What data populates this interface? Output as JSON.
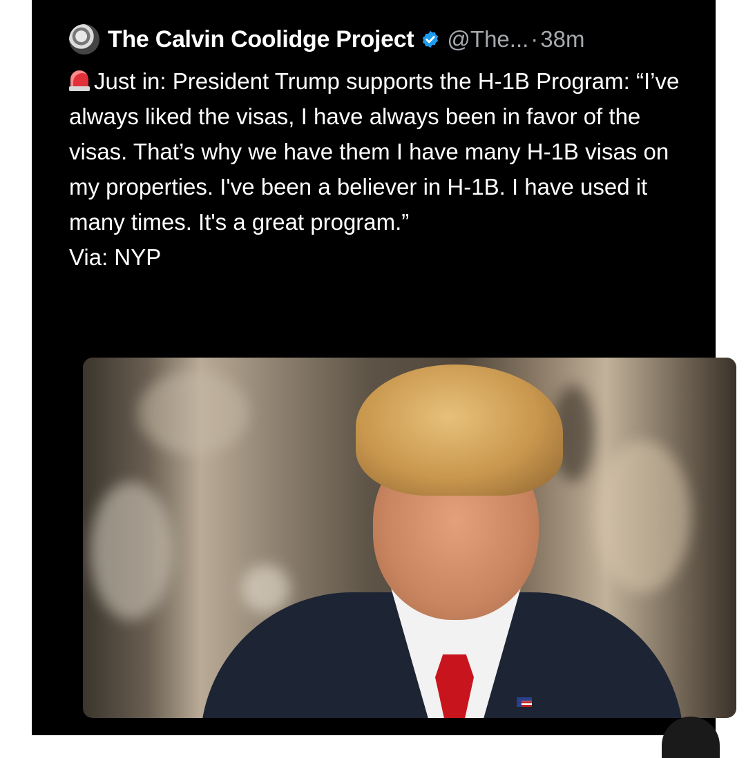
{
  "tweet": {
    "author_name": "The Calvin Coolidge Project",
    "handle": "@The...",
    "separator": "·",
    "time": "38m",
    "body_text": "Just in: President Trump supports the H-1B Program: “I’ve always liked the visas, I have always been in favor of the visas. That’s why we have them I have many H-1B visas on my properties. I've been a believer in H-1B. I have used it many times. It's a great program.”",
    "via_text": "Via: NYP",
    "icons": {
      "avatar": "avatar-image",
      "verified": "verified-badge-icon",
      "siren": "siren-emoji-icon"
    },
    "colors": {
      "background": "#000000",
      "text": "#ffffff",
      "secondary_text": "#a4a9ae",
      "verified_blue": "#1d9bf0"
    }
  }
}
